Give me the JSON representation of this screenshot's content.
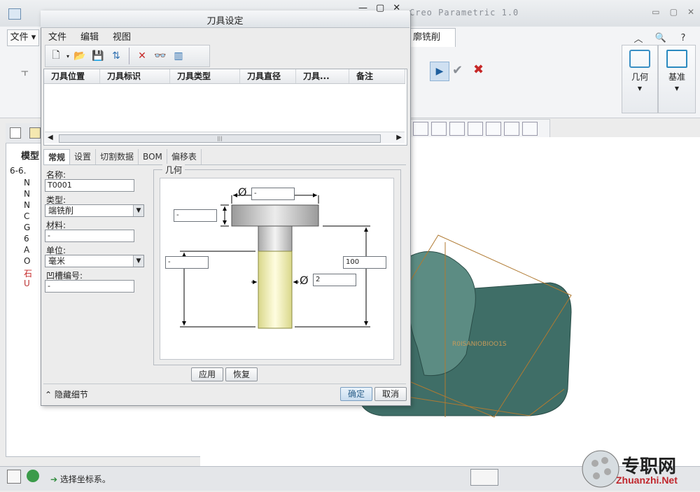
{
  "app": {
    "title_right": "Creo Parametric 1.0",
    "file_tab": "文件",
    "active_tab": "廓铣削",
    "ribbon_panels": [
      {
        "label": "几何"
      },
      {
        "label": "基准"
      }
    ],
    "model_tree_label": "模型",
    "tree_items": [
      "6-6.",
      "N",
      "N",
      "N",
      "C",
      "G",
      "6",
      "A",
      "O",
      "石",
      "U"
    ],
    "status_message": "选择坐标系。",
    "watermark_cn": "专职网",
    "watermark_en": "Zhuanzhi.Net"
  },
  "dialog": {
    "title": "刀具设定",
    "menu": [
      "文件",
      "编辑",
      "视图"
    ],
    "table": {
      "columns": [
        "刀具位置",
        "刀具标识",
        "刀具类型",
        "刀具直径",
        "刀具...",
        "备注"
      ]
    },
    "tabs": [
      "常规",
      "设置",
      "切割数据",
      "BOM",
      "偏移表"
    ],
    "active_tab_index": 0,
    "form": {
      "name_label": "名称:",
      "name_value": "T0001",
      "type_label": "类型:",
      "type_value": "端铣削",
      "material_label": "材料:",
      "material_value": "-",
      "unit_label": "单位:",
      "unit_value": "毫米",
      "groove_label": "凹槽编号:",
      "groove_value": "-"
    },
    "geometry": {
      "group_label": "几何",
      "top_dia": "-",
      "head_height": "-",
      "shank_len": "-",
      "total_len": "100",
      "diameter": "2",
      "diameter_symbol": "Ø"
    },
    "apply_label": "应用",
    "restore_label": "恢复",
    "hide_detail_label": "隐藏细节",
    "ok_label": "确定",
    "cancel_label": "取消"
  }
}
